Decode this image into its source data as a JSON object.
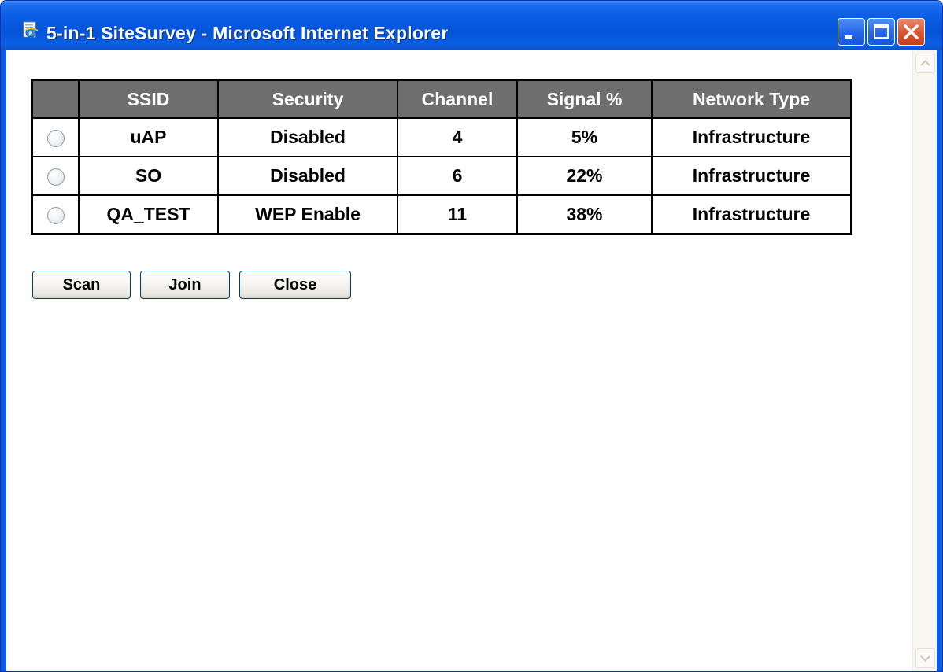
{
  "window": {
    "title": "5-in-1 SiteSurvey - Microsoft Internet Explorer",
    "icon": "ie-page-icon",
    "controls": [
      "minimize-icon",
      "maximize-icon",
      "close-icon"
    ]
  },
  "table": {
    "headers": {
      "select": "",
      "ssid": "SSID",
      "security": "Security",
      "channel": "Channel",
      "signal": "Signal %",
      "type": "Network Type"
    },
    "rows": [
      {
        "ssid": "uAP",
        "security": "Disabled",
        "channel": "4",
        "signal": "5%",
        "type": "Infrastructure",
        "selected": false
      },
      {
        "ssid": "SO",
        "security": "Disabled",
        "channel": "6",
        "signal": "22%",
        "type": "Infrastructure",
        "selected": false
      },
      {
        "ssid": "QA_TEST",
        "security": "WEP Enable",
        "channel": "11",
        "signal": "38%",
        "type": "Infrastructure",
        "selected": false
      }
    ]
  },
  "buttons": {
    "scan": "Scan",
    "join": "Join",
    "close": "Close"
  },
  "colors": {
    "titlebar": "#0454d8",
    "header_bg": "#6e6e6e",
    "header_text": "#ffffff"
  }
}
